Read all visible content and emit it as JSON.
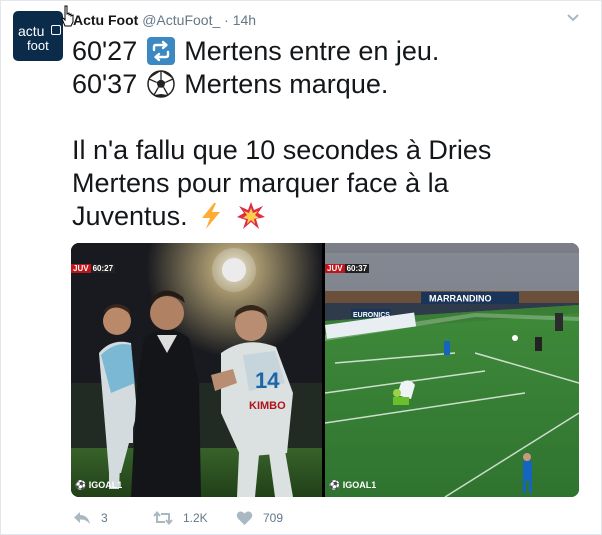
{
  "tweet": {
    "name": "Actu Foot",
    "handle": "@ActuFoot_",
    "separator": "·",
    "time": "14h",
    "lines": [
      {
        "prefix": "60'27",
        "icon": "repeat-emoji-icon",
        "suffix": "Mertens entre en jeu."
      },
      {
        "prefix": "60'37",
        "icon": "soccer-ball-emoji-icon",
        "suffix": "Mertens marque."
      }
    ],
    "body_line1": "Il n'a fallu que 10 secondes à Dries",
    "body_line2": "Mertens pour marquer face à la",
    "body_line3": "Juventus.",
    "body_icons": [
      "lightning-emoji-icon",
      "collision-emoji-icon"
    ]
  },
  "avatar": {
    "logo_top": "actu",
    "logo_bottom": "foot"
  },
  "media": {
    "left": {
      "team": "JUV",
      "clock": "60:27",
      "shirt_number": "14",
      "shirt_text": "KIMBO",
      "tag": "IGOAL1"
    },
    "right": {
      "team": "JUV",
      "clock": "60:37",
      "board1": "MARRANDINO",
      "board2": "EURONICS",
      "tag": "IGOAL1"
    }
  },
  "actions": {
    "reply_count": "3",
    "retweet_count": "1.2K",
    "like_count": "709"
  },
  "icons": [
    "reply-icon",
    "retweet-icon",
    "heart-icon",
    "chevron-down-icon",
    "cursor-icon"
  ],
  "colors": {
    "text": "#14171a",
    "muted": "#657786",
    "border": "#e1e8ed",
    "avatar_bg": "#0b2b4a",
    "juv_red": "#c0151b"
  }
}
